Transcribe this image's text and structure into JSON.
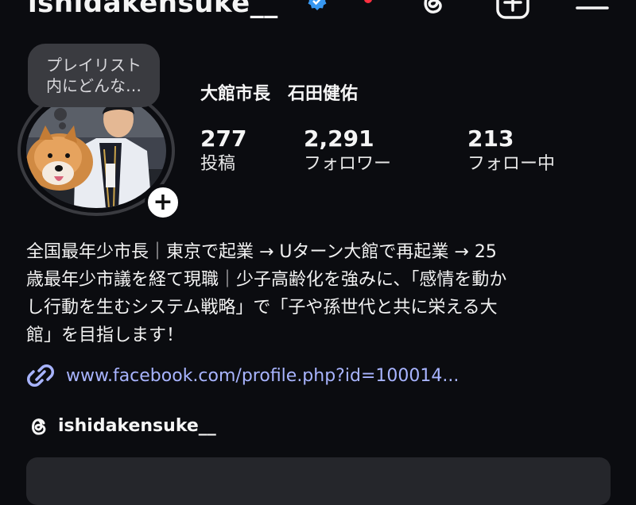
{
  "header": {
    "username": "ishidakensuke__",
    "colors": {
      "verified": "#3797f0",
      "notification": "#ff3040"
    }
  },
  "profile": {
    "note": "プレイリスト\n内にどんな…",
    "display_name": "大館市長　石田健佑",
    "stats": [
      {
        "value": "277",
        "label": "投稿"
      },
      {
        "value": "2,291",
        "label": "フォロワー"
      },
      {
        "value": "213",
        "label": "フォロー中"
      }
    ],
    "add_story_label": "+"
  },
  "bio": {
    "lines": [
      "全国最年少市長｜東京で起業 → Uターン大館で再起業 → 25",
      "歳最年少市議を経て現職｜少子高齢化を強みに、「感情を動か",
      "し行動を生むシステム戦略」で「子や孫世代と共に栄える大",
      "館」を目指します！"
    ]
  },
  "link": {
    "text": "www.facebook.com/profile.php?id=100014...",
    "color": "#a8b4ff"
  },
  "threads": {
    "handle": "ishidakensuke__"
  }
}
